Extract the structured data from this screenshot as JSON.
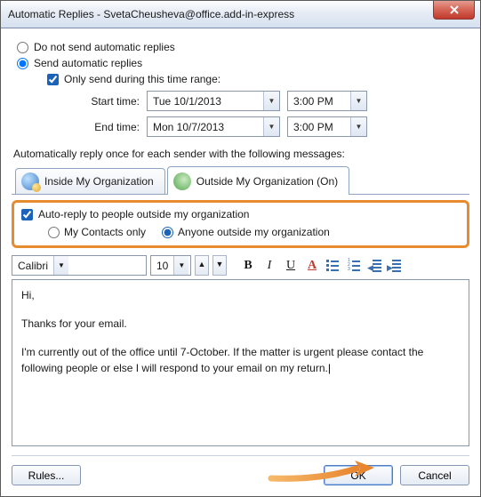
{
  "window": {
    "title": "Automatic Replies - SvetaCheusheva@office.add-in-express"
  },
  "options": {
    "do_not_send": "Do not send automatic replies",
    "send_auto": "Send automatic replies",
    "only_range": "Only send during this time range:",
    "start_label": "Start time:",
    "start_date": "Tue 10/1/2013",
    "start_time": "3:00 PM",
    "end_label": "End time:",
    "end_date": "Mon 10/7/2013",
    "end_time": "3:00 PM"
  },
  "section_label": "Automatically reply once for each sender with the following messages:",
  "tabs": {
    "inside": "Inside My Organization",
    "outside": "Outside My Organization (On)"
  },
  "outside_opts": {
    "auto_reply": "Auto-reply to people outside my organization",
    "contacts_only": "My Contacts only",
    "anyone": "Anyone outside my organization"
  },
  "toolbar": {
    "font_name": "Calibri",
    "font_size": "10"
  },
  "message": {
    "l1": "Hi,",
    "l2": "Thanks for your email.",
    "l3": "I'm currently out of the office until 7-October. If the matter is urgent please contact the following people or else I will respond to your email on my return."
  },
  "buttons": {
    "rules": "Rules...",
    "ok": "OK",
    "cancel": "Cancel"
  }
}
